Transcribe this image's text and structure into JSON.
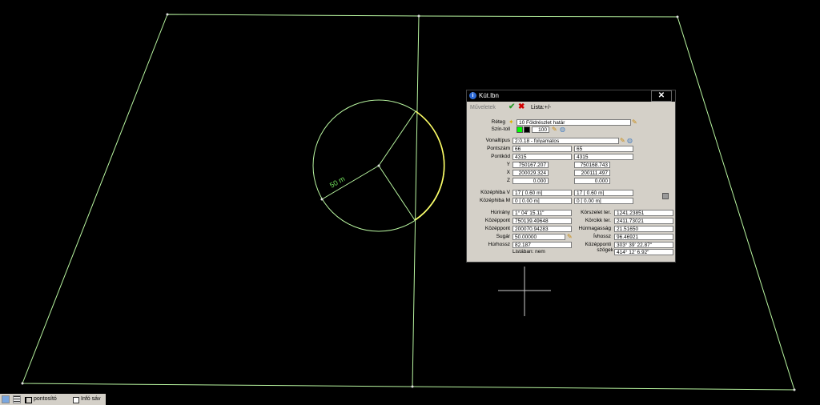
{
  "window": {
    "title": "Kút.lbn",
    "close": "✕"
  },
  "toolbar": {
    "menu_label": "Műveletek",
    "ok_icon": "check-icon",
    "cancel_icon": "x-icon",
    "lista_label": "Lista:+/-"
  },
  "layer": {
    "label": "Réteg",
    "value": "10 Földrészlet határ"
  },
  "pen": {
    "label": "Szín-toll",
    "color1": "#00ff00",
    "color2": "#000000",
    "value": "100"
  },
  "linetype": {
    "label": "Vonaltípus",
    "value": "2:0.18 - folyamatos"
  },
  "labels": {
    "pointnum": "Pontszám",
    "pointcode": "Pontkód",
    "y": "Y",
    "x": "X",
    "z": "Z",
    "midv": "Középhiba V",
    "midm": "Középhiba M",
    "hurirany": "Húrirány",
    "kozeppont1": "Középpont",
    "kozeppont2": "Középpont",
    "sugar": "Sugár",
    "hurhossz": "Húrhossz",
    "listaban": "Listában: nem",
    "korszelet": "Körszelet ter.",
    "korcikk": "Körcikk ter.",
    "hurmagassag": "Húrmagasság",
    "ivhossz": "Ívhossz",
    "kozepponti1": "Középponti",
    "kozepponti2": "szögek"
  },
  "col1": {
    "pointnum": "66",
    "pointcode": "4315",
    "y": "750167.207",
    "x": "200029.324",
    "z": "0.000",
    "midv": "17   [ 0.60 m]",
    "midm": "0   [ 0.00 m]"
  },
  "col2": {
    "pointnum": "65",
    "pointcode": "4315",
    "y": "750168.743",
    "x": "200111.497",
    "z": "0.000",
    "midv": "17   [ 0.60 m]",
    "midm": "0   [ 0.00 m]"
  },
  "arc": {
    "hurirany": "1° 04' 15.11\"",
    "kozeppont_y": "750139.49648",
    "kozeppont_x": "200070.94283",
    "sugar": "50.00000",
    "hurhossz": "82.187",
    "korszelet": "1241.23851",
    "korcikk": "2411.73021",
    "hurmagassag": "21.51650",
    "ivhossz": "96.46921",
    "szog1": "303°  39' 22.87\"",
    "szog2": "414°  12'  6.92\""
  },
  "drawing": {
    "radius_label": "50 m",
    "line_color": "#b8f5a0",
    "arc_color": "#ffff66"
  },
  "statusbar": {
    "pontosito": "pontosító",
    "infosav": "Infó sáv"
  }
}
